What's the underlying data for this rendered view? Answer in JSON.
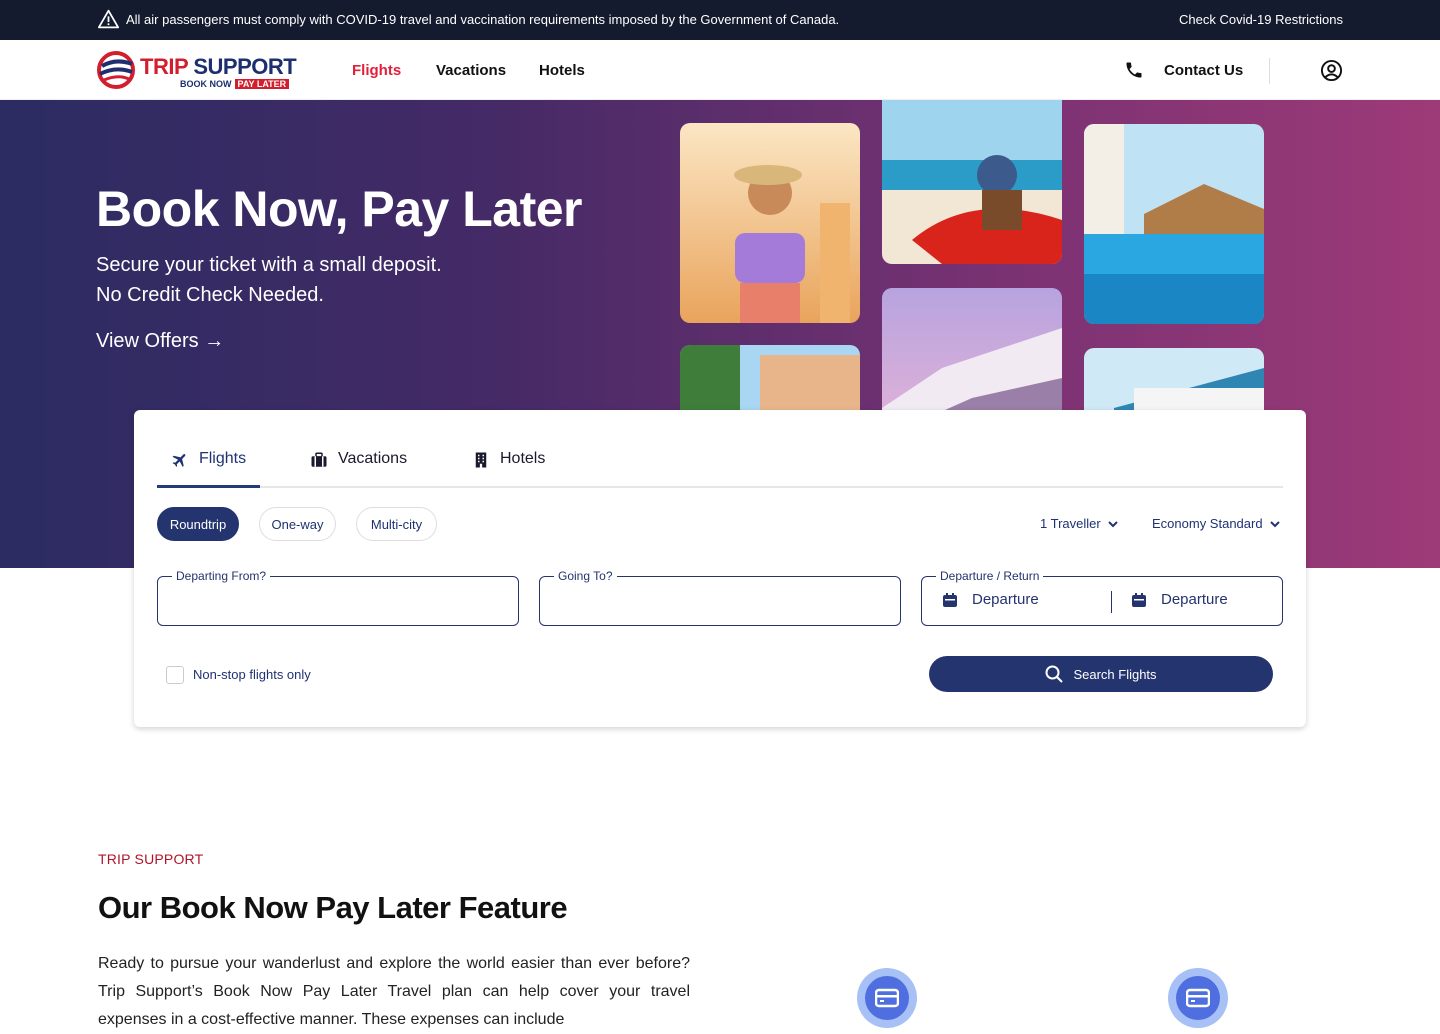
{
  "notice": {
    "message": "All air passengers must comply with COVID-19 travel and vaccination requirements imposed by the Government of Canada.",
    "link": "Check Covid-19 Restrictions"
  },
  "header": {
    "logo": {
      "trip": "TRIP",
      "support": "SUPPORT",
      "book_now": "BOOK NOW",
      "pay_later": "PAY LATER"
    },
    "nav": [
      {
        "label": "Flights",
        "active": true
      },
      {
        "label": "Vacations",
        "active": false
      },
      {
        "label": "Hotels",
        "active": false
      }
    ],
    "contact": "Contact Us"
  },
  "hero": {
    "title": "Book Now, Pay Later",
    "subtitle_line1": "Secure your ticket with a small deposit.",
    "subtitle_line2": "No Credit Check Needed.",
    "cta": "View Offers"
  },
  "search": {
    "tabs": [
      {
        "label": "Flights",
        "icon": "plane-icon",
        "active": true
      },
      {
        "label": "Vacations",
        "icon": "suitcase-icon",
        "active": false
      },
      {
        "label": "Hotels",
        "icon": "building-icon",
        "active": false
      }
    ],
    "trip_types": [
      {
        "label": "Roundtrip",
        "active": true
      },
      {
        "label": "One-way",
        "active": false
      },
      {
        "label": "Multi-city",
        "active": false
      }
    ],
    "travellers": "1 Traveller",
    "cabin": "Economy Standard",
    "from_label": "Departing From?",
    "to_label": "Going To?",
    "dates_label": "Departure / Return",
    "depart_placeholder": "Departure",
    "return_placeholder": "Departure",
    "nonstop_label": "Non-stop flights only",
    "search_button": "Search Flights"
  },
  "feature": {
    "eyebrow": "TRIP SUPPORT",
    "title": "Our Book Now Pay Later Feature",
    "body": "Ready to pursue your wanderlust and explore the world easier than ever before? Trip Support’s Book Now Pay Later Travel plan can help cover your travel expenses in a cost-effective manner. These expenses can include"
  },
  "colors": {
    "navy": "#24346e",
    "brand_red": "#d21f2e",
    "nav_active": "#e0213a",
    "notice_bg": "#141b2e",
    "eyebrow": "#b0142a"
  }
}
